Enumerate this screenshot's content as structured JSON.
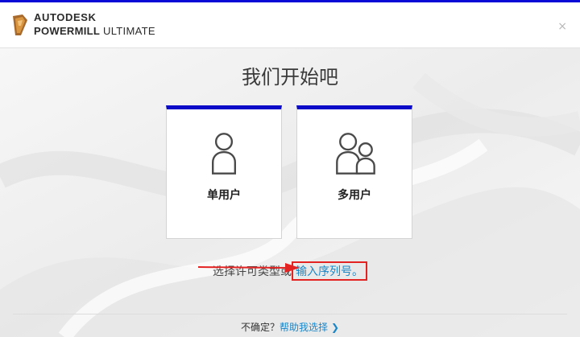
{
  "header": {
    "brand_line1": "AUTODESK",
    "brand_line2_bold": "POWERMILL",
    "brand_line2_rest": " ULTIMATE",
    "close_symbol": "×"
  },
  "main": {
    "title": "我们开始吧",
    "cards": [
      {
        "label": "单用户",
        "icon": "single-user-icon"
      },
      {
        "label": "多用户",
        "icon": "multi-user-icon"
      }
    ],
    "license_prompt": "选择许可类型或",
    "serial_link": "输入序列号。"
  },
  "footer": {
    "question": "不确定？",
    "help_link": "帮助我选择",
    "chevron": "❯"
  },
  "colors": {
    "accent_blue": "#0c0cc8",
    "link_blue": "#1a86c8",
    "annotation_red": "#e32222"
  }
}
